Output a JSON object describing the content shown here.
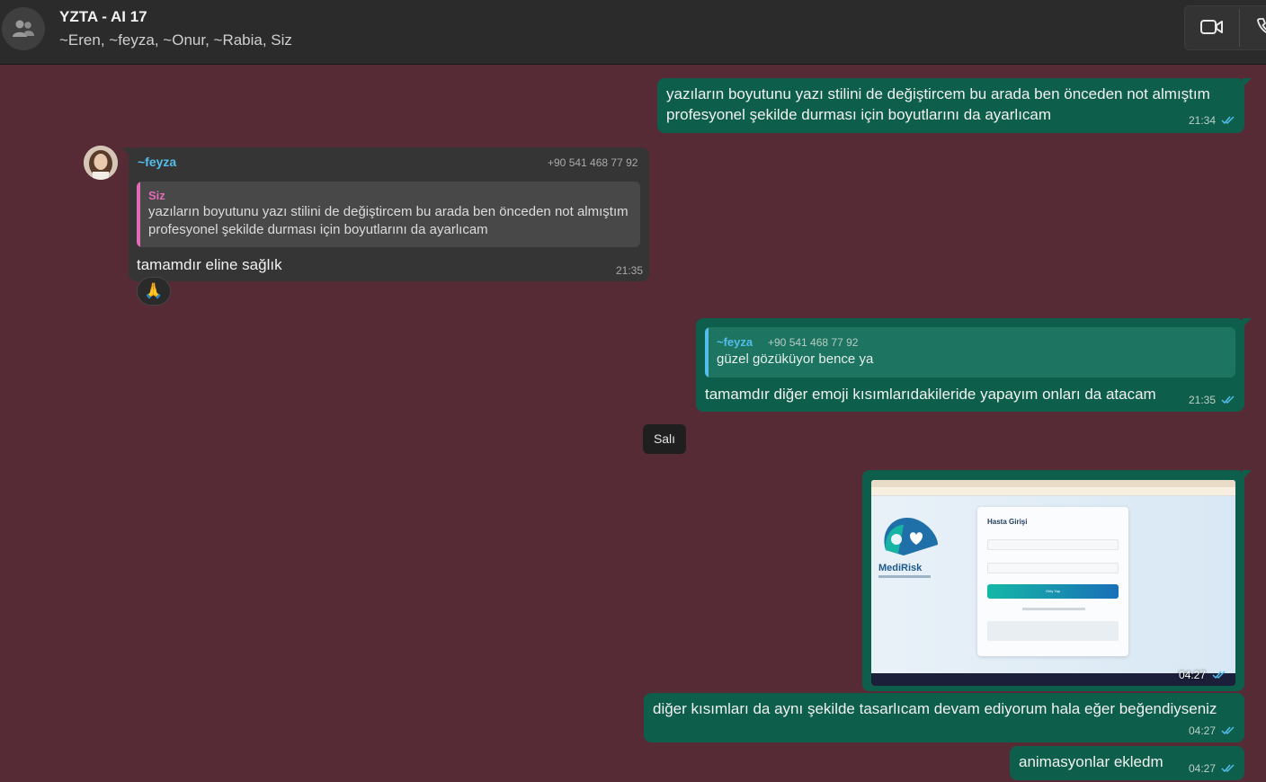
{
  "header": {
    "title": "YZTA - AI 17",
    "members": "~Eren, ~feyza, ~Onur, ~Rabia, Siz"
  },
  "messages": [
    {
      "direction": "out",
      "lines": [
        "yazıların boyutunu yazı stilini de değiştircem bu arada ben önceden not almıştım",
        "profesyonel şekilde durması için  boyutlarını da ayarlıcam"
      ],
      "time": "21:34",
      "status": "read"
    },
    {
      "direction": "in",
      "sender": "~feyza",
      "phone": "+90 541 468 77 92",
      "quote": {
        "author": "Siz",
        "lines": [
          "yazıların boyutunu yazı stilini de değiştircem bu arada ben önceden not almıştım",
          "profesyonel şekilde durması için  boyutlarını da ayarlıcam"
        ]
      },
      "text": "tamamdır eline sağlık",
      "time": "21:35",
      "reaction": "🙏"
    },
    {
      "direction": "out",
      "quote": {
        "author": "~feyza",
        "phone": "+90 541 468 77 92",
        "text": "güzel gözüküyor bence ya"
      },
      "text": "tamamdır diğer emoji kısımlarıdakileride yapayım onları da atacam",
      "time": "21:35",
      "status": "read"
    },
    {
      "direction": "out",
      "type": "image",
      "image": {
        "title": "Hasta Girişi",
        "brand": "MediRisk",
        "button": "Giriş Yap"
      },
      "time": "04:27",
      "status": "read"
    },
    {
      "direction": "out",
      "text": "diğer kısımları da aynı şekilde tasarlıcam devam ediyorum hala eğer beğendiyseniz",
      "time": "04:27",
      "status": "read"
    },
    {
      "direction": "out",
      "text": "animasyonlar ekledm",
      "time": "04:27",
      "status": "read"
    }
  ],
  "day_separator": "Salı",
  "colors": {
    "chat_bg": "#572b36",
    "outgoing_bubble": "#0d5e4a",
    "incoming_bubble": "#353535",
    "sender_name": "#53bdeb",
    "quote_self": "#e26ab6",
    "read_ticks": "#53bdeb"
  },
  "icons": [
    "group-avatar-icon",
    "video-call-icon",
    "phone-call-icon",
    "double-check-icon"
  ]
}
